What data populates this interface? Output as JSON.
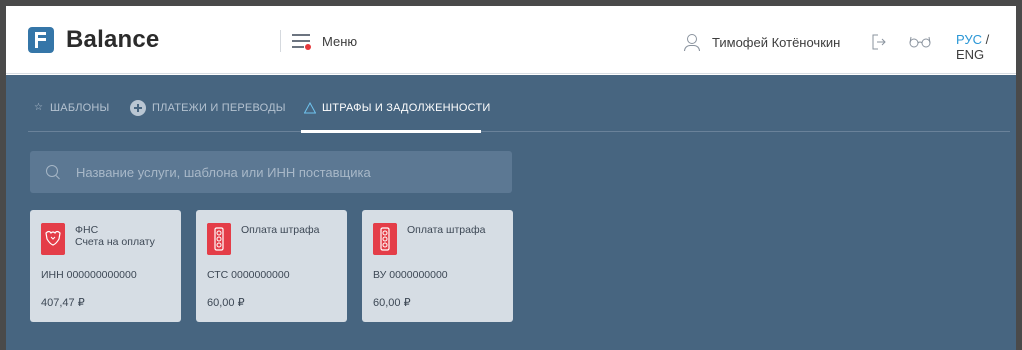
{
  "app": {
    "name": "Balance"
  },
  "header": {
    "menu_label": "Меню",
    "user_name": "Тимофей Котёночкин",
    "lang_active": "РУС",
    "lang_sep": " / ",
    "lang_other": "ENG"
  },
  "tabs": [
    {
      "label": "ШАБЛОНЫ",
      "icon": "star-icon",
      "active": false
    },
    {
      "label": "ПЛАТЕЖИ И ПЕРЕВОДЫ",
      "icon": "plus-circle-icon",
      "active": false
    },
    {
      "label": "ШТРАФЫ И ЗАДОЛЖЕННОСТИ",
      "icon": "warning-icon",
      "active": true
    }
  ],
  "search": {
    "placeholder": "Название услуги, шаблона или ИНН поставщика"
  },
  "cards": [
    {
      "title": "ФНС",
      "subtitle": "Счета на оплату",
      "identifier": "ИНН 000000000000",
      "amount": "407,47 ₽",
      "icon": "eagle-emblem-icon"
    },
    {
      "title": "Оплата штрафа",
      "subtitle": "",
      "identifier": "СТС 0000000000",
      "amount": "60,00 ₽",
      "icon": "traffic-light-icon"
    },
    {
      "title": "Оплата штрафа",
      "subtitle": "",
      "identifier": "ВУ 0000000000",
      "amount": "60,00 ₽",
      "icon": "traffic-light-icon"
    }
  ],
  "colors": {
    "brand": "#3576a8",
    "panel": "#476580",
    "card": "#d6dde4",
    "card_icon": "#e43d48",
    "lang_active": "#2b97d6"
  }
}
